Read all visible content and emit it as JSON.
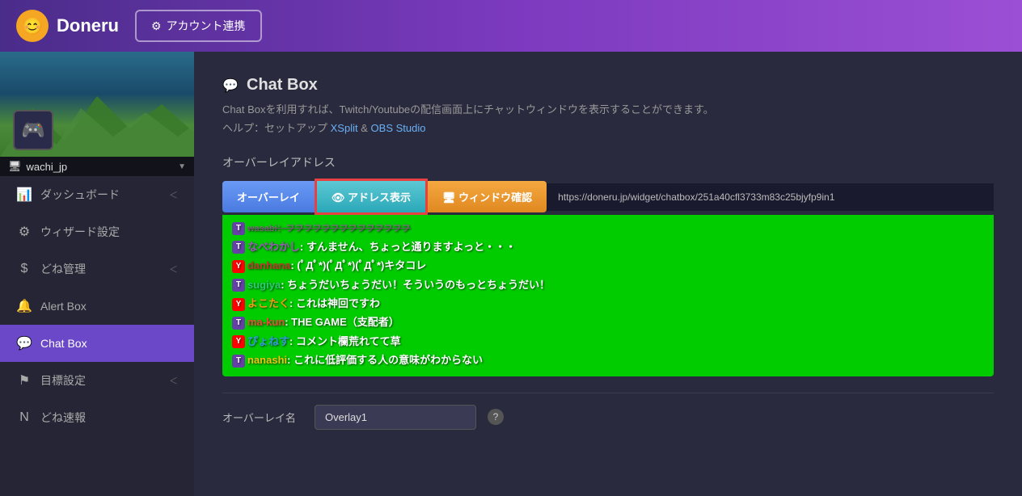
{
  "header": {
    "logo_text": "Doneru",
    "logo_emoji": "😊",
    "account_btn": "アカウント連携",
    "gear_icon": "⚙"
  },
  "sidebar": {
    "user": {
      "name": "wachi_jp",
      "avatar_emoji": "🎮",
      "chevron": "▼"
    },
    "nav_items": [
      {
        "id": "dashboard",
        "icon": "📊",
        "label": "ダッシュボード",
        "has_chevron": true,
        "active": false
      },
      {
        "id": "wizard",
        "icon": "⚙",
        "label": "ウィザード設定",
        "has_chevron": false,
        "active": false
      },
      {
        "id": "done-manage",
        "icon": "$",
        "label": "どね管理",
        "has_chevron": true,
        "active": false
      },
      {
        "id": "alert-box",
        "icon": "🔔",
        "label": "Alert Box",
        "has_chevron": false,
        "active": false
      },
      {
        "id": "chat-box",
        "icon": "💬",
        "label": "Chat Box",
        "has_chevron": false,
        "active": true
      },
      {
        "id": "goal",
        "icon": "⚑",
        "label": "目標設定",
        "has_chevron": true,
        "active": false
      },
      {
        "id": "done-news",
        "icon": "N",
        "label": "どね速報",
        "has_chevron": false,
        "active": false
      }
    ]
  },
  "content": {
    "page_icon": "💬",
    "page_title": "Chat Box",
    "desc_line1": "Chat Boxを利用すれば、Twitch/Youtubeの配信画面上にチャットウィンドウを表示することができます。",
    "desc_line2": "ヘルプ：セットアップ",
    "link_xsplit": "XSplit",
    "link_amp": "& ",
    "link_obs": "OBS Studio",
    "section_overlay": "オーバーレイアドレス",
    "btn_overlay": "オーバーレイ",
    "btn_address": "👁 アドレス表示",
    "btn_window": "🖥 ウィンドウ確認",
    "url": "https://doneru.jp/widget/chatbox/251a40cfl3733m83c25bjyfp9in1",
    "chat_messages": [
      {
        "platform": "twitch",
        "username": "wasabi：フフフフフフフフフフフフフフ",
        "message": "",
        "username_color": "#888",
        "is_strikethrough": true
      },
      {
        "platform": "twitch",
        "username": "なべわかし",
        "message": "すんません、ちょっと通りますよっと・・・",
        "username_color": "#9b59b6"
      },
      {
        "platform": "youtube",
        "username": "danhana",
        "message": "(ﾟДﾟ*)(ﾟДﾟ*)(ﾟДﾟ*)キタコレ",
        "username_color": "#c0392b"
      },
      {
        "platform": "twitch",
        "username": "sugiya",
        "message": "ちょうだいちょうだい！そういうのもっとちょうだい！",
        "username_color": "#2ecc71"
      },
      {
        "platform": "youtube",
        "username": "よこたく",
        "message": "これは神回ですわ",
        "username_color": "#f39c12"
      },
      {
        "platform": "twitch",
        "username": "ma-kun",
        "message": "THE GAME（支配者）",
        "username_color": "#e74c3c"
      },
      {
        "platform": "youtube",
        "username": "ぴょねす",
        "message": "コメント欄荒れてて草",
        "username_color": "#3498db"
      },
      {
        "platform": "twitch",
        "username": "nanashi",
        "message": "これに低評価する人の意味がわからない",
        "username_color": "#f1c40f"
      }
    ],
    "overlay_name_label": "オーバーレイ名",
    "overlay_name_value": "Overlay1"
  }
}
